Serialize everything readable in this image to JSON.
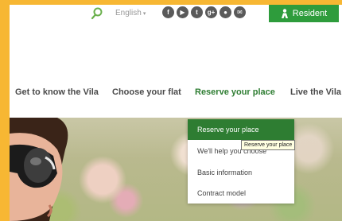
{
  "topbar": {
    "language": "English",
    "social_icons": [
      "facebook-icon",
      "youtube-icon",
      "twitter-icon",
      "google-plus-icon",
      "location-icon",
      "mail-icon"
    ],
    "social_glyphs": [
      "f",
      "▶",
      "t",
      "g+",
      "●",
      "✉"
    ],
    "resident_label": "Resident"
  },
  "nav": {
    "items": [
      {
        "label": "Get to know the Vila"
      },
      {
        "label": "Choose your flat"
      },
      {
        "label": "Reserve your place",
        "active": true
      },
      {
        "label": "Live the Vila"
      }
    ]
  },
  "dropdown": {
    "items": [
      {
        "label": "Reserve your place",
        "active": true
      },
      {
        "label": "We'll help you choose"
      },
      {
        "label": "Basic information"
      },
      {
        "label": "Contract model"
      }
    ],
    "tooltip": "Reserve your place"
  },
  "colors": {
    "accent_green": "#2e7d32",
    "resident_green": "#2e9c3c",
    "page_border": "#f7b733"
  }
}
